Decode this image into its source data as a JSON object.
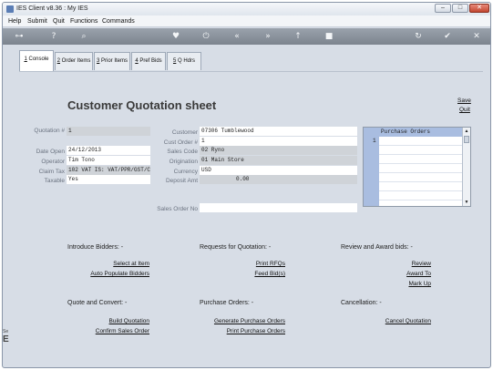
{
  "window": {
    "title": "IES Client v8.36 : My IES"
  },
  "menu": {
    "items": [
      "Help",
      "Submit",
      "Quit",
      "Functions",
      "Commands"
    ]
  },
  "tabs": [
    {
      "key": "1",
      "label": " Console"
    },
    {
      "key": "2",
      "label": " Order Items"
    },
    {
      "key": "3",
      "label": " Prior Items"
    },
    {
      "key": "4",
      "label": " Pref Bids"
    },
    {
      "key": "5",
      "label": " Q Hdrs"
    }
  ],
  "page": {
    "title": "Customer Quotation sheet",
    "save_label": "Save",
    "quit_label": "Quit"
  },
  "form": {
    "quotation_label": "Quotation #",
    "quotation_value": "1",
    "date_open_label": "Date Open",
    "date_open_value": "24/12/2013",
    "operator_label": "Operator",
    "operator_value": "Tim Tono",
    "claim_tax_label": "Claim Tax",
    "claim_tax_value": "102 VAT IS: VAT/PPR/GST/C",
    "taxable_label": "Taxable",
    "taxable_value": "Yes",
    "customer_label": "Customer",
    "customer_value": "07306 Tumblewood",
    "cust_order_label": "Cust Order #",
    "cust_order_value": "1",
    "sales_code_label": "Sales Code",
    "sales_code_value": "02 Ryno",
    "origination_label": "Origination",
    "origination_value": "01 Main Store",
    "currency_label": "Currency",
    "currency_value": "USD",
    "deposit_label": "Deposit Amt",
    "deposit_value": "0.00",
    "sales_order_label": "Sales Order No",
    "sales_order_value": ""
  },
  "purchase_orders": {
    "header": "Purchase Orders",
    "rows": [
      "1"
    ]
  },
  "sections": {
    "introduce": {
      "heading": "Introduce Bidders: -",
      "actions": [
        "Select at Item",
        "Auto Populate Bidders"
      ]
    },
    "rfq": {
      "heading": "Requests for Quotation: -",
      "actions": [
        "Print RFQs",
        "Feed Bid(s)"
      ]
    },
    "review": {
      "heading": "Review and Award bids: -",
      "actions": [
        "Review",
        "Award To",
        "Mark Up"
      ]
    },
    "quote": {
      "heading": "Quote and Convert: -",
      "actions": [
        "Build Quotation",
        "Confirm Sales Order"
      ]
    },
    "po": {
      "heading": "Purchase Orders: -",
      "actions": [
        "Generate Purchase Orders",
        "Print Purchase Orders"
      ]
    },
    "cancel": {
      "heading": "Cancellation: -",
      "actions": [
        "Cancel Quotation"
      ]
    }
  },
  "side": {
    "small": "Se",
    "big": "E"
  }
}
